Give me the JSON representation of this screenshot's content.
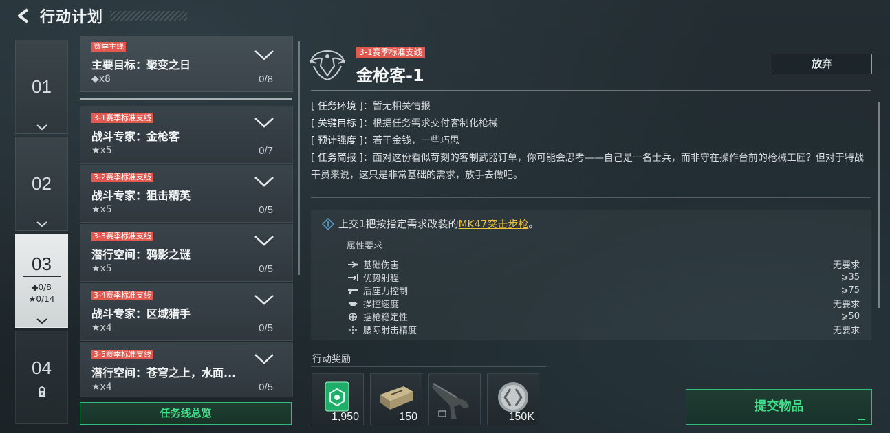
{
  "header": {
    "title": "行动计划"
  },
  "chapters": [
    {
      "num": "01"
    },
    {
      "num": "02"
    },
    {
      "num": "03",
      "diamond_progress": "0/8",
      "star_progress": "0/14"
    },
    {
      "num": "04"
    }
  ],
  "quests": [
    {
      "tag": "赛季主线",
      "name": "主要目标：聚变之日",
      "count": "◆x8",
      "progress": "0/8"
    },
    {
      "tag": "3-1赛季标准支线",
      "name": "战斗专家：金枪客",
      "count": "★x5",
      "progress": "0/7"
    },
    {
      "tag": "3-2赛季标准支线",
      "name": "战斗专家：狙击精英",
      "count": "★x5",
      "progress": "0/5"
    },
    {
      "tag": "3-3赛季标准支线",
      "name": "潜行空间：鸦影之谜",
      "count": "★x5",
      "progress": "0/5"
    },
    {
      "tag": "3-4赛季标准支线",
      "name": "战斗专家：区域猎手",
      "count": "★x4",
      "progress": "0/5"
    },
    {
      "tag": "3-5赛季标准支线",
      "name": "潜行空间：苍穹之上，水面...",
      "count": "★x4",
      "progress": "0/5"
    }
  ],
  "overview_button": "任务线总览",
  "detail": {
    "tag": "3-1赛季标准支线",
    "title": "金枪客-1",
    "abandon": "放弃",
    "info": [
      {
        "key": "[ 任务环境 ]",
        "value": "：暂无相关情报"
      },
      {
        "key": "[ 关键目标 ]",
        "value": "：根据任务需求交付客制化枪械"
      },
      {
        "key": "[ 预计强度 ]",
        "value": "：若干金钱，一些巧思"
      },
      {
        "key": "[ 任务简报 ]",
        "value": "：面对这份看似苛刻的客制武器订单，你可能会思考——自己是一名士兵，而非守在操作台前的枪械工匠？但对于特战干员来说，这只是非常基础的需求，放手去做吧。"
      }
    ],
    "requirement": {
      "prefix": "上交1把按指定需求改装的",
      "item": "MK47突击步枪",
      "suffix": "。"
    },
    "attr_title": "属性要求",
    "attributes": [
      {
        "name": "基础伤害",
        "value": "无要求",
        "icon": "damage-icon"
      },
      {
        "name": "优势射程",
        "value": "⩾35",
        "icon": "range-icon"
      },
      {
        "name": "后座力控制",
        "value": "⩾75",
        "icon": "recoil-icon"
      },
      {
        "name": "操控速度",
        "value": "无要求",
        "icon": "handling-icon"
      },
      {
        "name": "据枪稳定性",
        "value": "⩾50",
        "icon": "stability-icon"
      },
      {
        "name": "腰际射击精度",
        "value": "无要求",
        "icon": "hipfire-icon"
      }
    ],
    "rewards_title": "行动奖励",
    "rewards": [
      {
        "qty": "1,950",
        "icon": "exp-card-icon"
      },
      {
        "qty": "150",
        "icon": "ammo-box-icon"
      },
      {
        "qty": "",
        "icon": "rifle-icon"
      },
      {
        "qty": "150K",
        "icon": "coin-icon"
      }
    ],
    "submit": "提交物品"
  }
}
